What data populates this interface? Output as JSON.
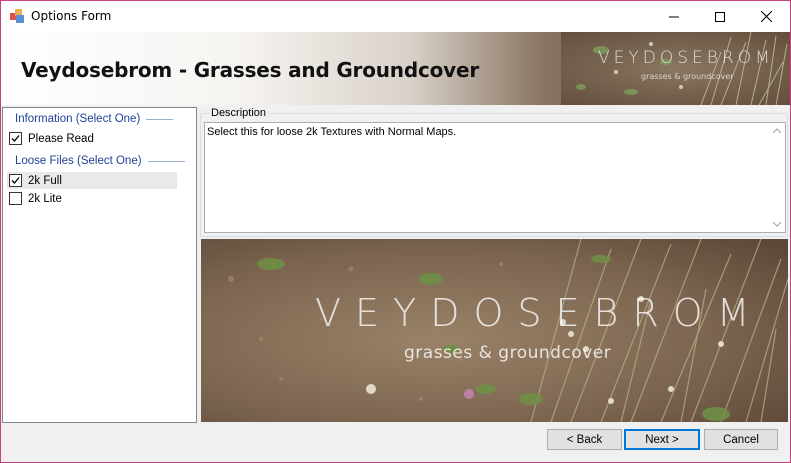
{
  "window": {
    "title": "Options Form",
    "icon": "app-window-icon"
  },
  "banner": {
    "title": "Veydosebrom - Grasses and Groundcover",
    "watermark": "VEYDOSEBROM",
    "watermark_sub": "grasses & groundcover"
  },
  "options": {
    "groups": [
      {
        "label": "Information (Select One)",
        "items": [
          {
            "label": "Please Read",
            "checked": true
          }
        ]
      },
      {
        "label": "Loose Files (Select One)",
        "items": [
          {
            "label": "2k Full",
            "checked": true,
            "selected": true
          },
          {
            "label": "2k Lite",
            "checked": false
          }
        ]
      }
    ]
  },
  "description": {
    "legend": "Description",
    "text": "Select this for loose 2k Textures with Normal Maps."
  },
  "preview": {
    "title": "VEYDOSEBROM",
    "subtitle": "grasses & groundcover"
  },
  "buttons": {
    "back": "< Back",
    "next": "Next >",
    "cancel": "Cancel"
  },
  "colors": {
    "window_border": "#c3427e",
    "group_header": "#1e3f96",
    "default_button_border": "#0078d7"
  }
}
